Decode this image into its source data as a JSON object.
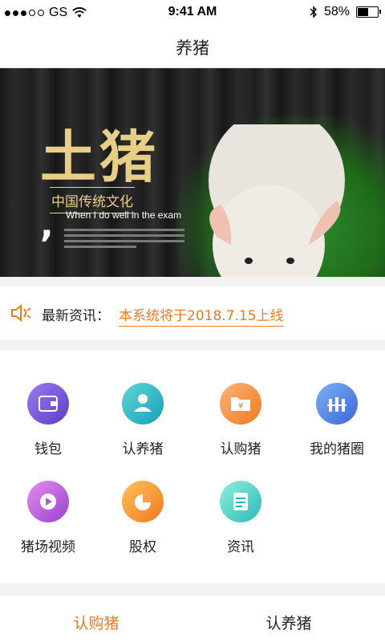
{
  "status_bar": {
    "carrier": "GS",
    "time": "9:41 AM",
    "battery": "58%"
  },
  "nav": {
    "title": "养猪"
  },
  "banner": {
    "title": "土猪",
    "subtitle": "中国传统文化",
    "english": "When I do well in the exam",
    "slides": 5,
    "active_slide": 0
  },
  "news": {
    "label": "最新资讯：",
    "text": "本系统将于2018.7.15上线"
  },
  "menu": {
    "items": [
      {
        "label": "钱包",
        "icon": "wallet-icon",
        "color": "#7b5fd6"
      },
      {
        "label": "认养猪",
        "icon": "person-icon",
        "color": "#2ab7c7"
      },
      {
        "label": "认购猪",
        "icon": "folder-yen-icon",
        "color": "#f6924a"
      },
      {
        "label": "我的猪圈",
        "icon": "fence-icon",
        "color": "#4b7be2"
      },
      {
        "label": "猪场视频",
        "icon": "play-icon",
        "color": "#b35ad6"
      },
      {
        "label": "股权",
        "icon": "pie-chart-icon",
        "color": "#f08a1e"
      },
      {
        "label": "资讯",
        "icon": "document-icon",
        "color": "#3cc8c0"
      }
    ]
  },
  "tabs": [
    {
      "label": "认购猪",
      "active": true
    },
    {
      "label": "认养猪",
      "active": false
    }
  ]
}
